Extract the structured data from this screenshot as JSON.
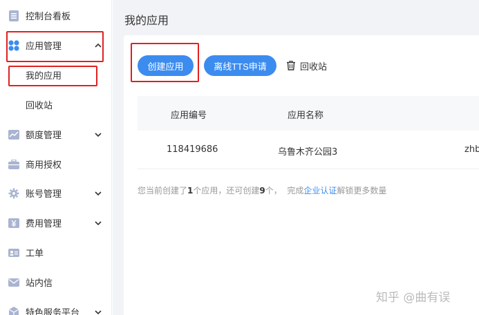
{
  "sidebar": {
    "items": [
      {
        "label": "控制台看板",
        "icon": "dashboard-icon"
      },
      {
        "label": "应用管理",
        "icon": "apps-icon",
        "expanded": true,
        "children": [
          {
            "label": "我的应用",
            "selected": true
          },
          {
            "label": "回收站"
          }
        ]
      },
      {
        "label": "额度管理",
        "icon": "chart-icon"
      },
      {
        "label": "商用授权",
        "icon": "briefcase-icon"
      },
      {
        "label": "账号管理",
        "icon": "gear-icon"
      },
      {
        "label": "费用管理",
        "icon": "yen-icon"
      },
      {
        "label": "工单",
        "icon": "id-card-icon"
      },
      {
        "label": "站内信",
        "icon": "mail-icon"
      },
      {
        "label": "特色服务平台",
        "icon": "cube-icon"
      }
    ]
  },
  "main": {
    "title": "我的应用",
    "toolbar": {
      "create_label": "创建应用",
      "offline_tts_label": "离线TTS申请",
      "recycle_label": "回收站"
    },
    "table": {
      "columns": [
        "应用编号",
        "应用名称"
      ],
      "rows": [
        {
          "id": "118419686",
          "name": "乌鲁木齐公园3",
          "extra": "zhb"
        }
      ]
    },
    "summary": {
      "prefix": "您当前创建了",
      "created": "1",
      "mid": "个应用，还可创建",
      "remaining": "9",
      "suffix": "个，  完成",
      "link": "企业认证",
      "tail": "解锁更多数量"
    }
  },
  "watermark": "知乎 @曲有误",
  "colors": {
    "primary": "#3c8cf0",
    "highlight": "#e02020",
    "background": "#f2f3f7"
  }
}
